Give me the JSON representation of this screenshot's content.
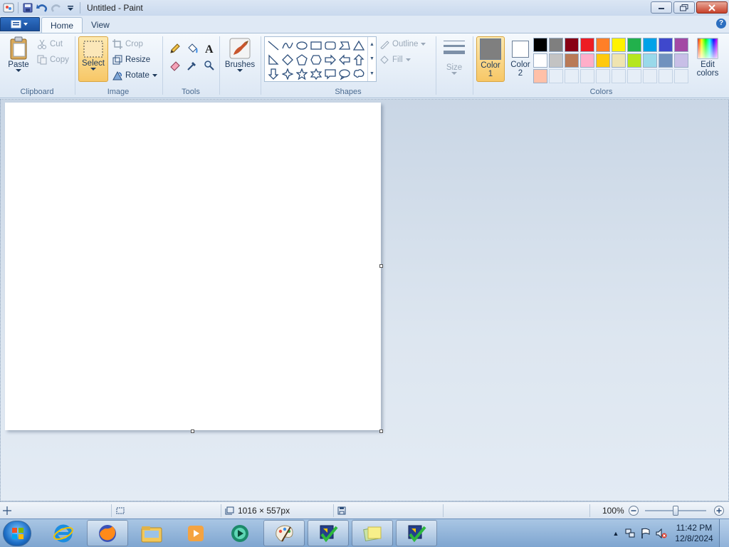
{
  "window": {
    "title": "Untitled - Paint"
  },
  "tabs": [
    {
      "label": "Home",
      "active": true
    },
    {
      "label": "View",
      "active": false
    }
  ],
  "ribbon": {
    "clipboard": {
      "label": "Clipboard",
      "paste": "Paste",
      "cut": "Cut",
      "copy": "Copy"
    },
    "image": {
      "label": "Image",
      "select": "Select",
      "crop": "Crop",
      "resize": "Resize",
      "rotate": "Rotate"
    },
    "tools": {
      "label": "Tools"
    },
    "brushes": {
      "label": "Brushes"
    },
    "shapes": {
      "label": "Shapes",
      "outline": "Outline",
      "fill": "Fill"
    },
    "size": {
      "label": "Size"
    },
    "colors": {
      "label": "Colors",
      "color1_line1": "Color",
      "color1_line2": "1",
      "color2_line1": "Color",
      "color2_line2": "2",
      "edit_line1": "Edit",
      "edit_line2": "colors",
      "color1_value": "#7f7f7f",
      "color2_value": "#ffffff",
      "palette": [
        "#000000",
        "#7f7f7f",
        "#880015",
        "#ed1c24",
        "#ff7f27",
        "#fff200",
        "#22b14c",
        "#00a2e8",
        "#3f48cc",
        "#a349a4",
        "#ffffff",
        "#c3c3c3",
        "#b97a57",
        "#ffaec9",
        "#ffc90e",
        "#efe4b0",
        "#b5e61d",
        "#99d9ea",
        "#7092be",
        "#c8bfe7",
        "#ffc0a8",
        "#e6eef7",
        "#e6eef7",
        "#e6eef7",
        "#e6eef7",
        "#e6eef7",
        "#e6eef7",
        "#e6eef7",
        "#e6eef7",
        "#e6eef7"
      ]
    }
  },
  "statusbar": {
    "dimensions": "1016 × 557px",
    "zoom": "100%"
  },
  "taskbar": {
    "clock_time": "11:42 PM",
    "clock_date": "12/8/2024"
  }
}
